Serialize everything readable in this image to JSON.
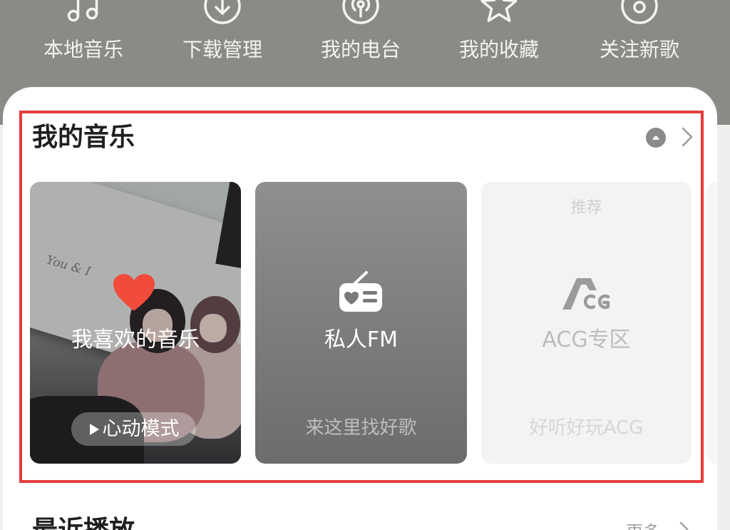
{
  "colors": {
    "header_bg": "#8b8a86",
    "highlight": "#e63c3c",
    "heart": "#f04b3b"
  },
  "top_nav": {
    "items": [
      {
        "label": "本地音乐",
        "icon": "music-note-icon"
      },
      {
        "label": "下载管理",
        "icon": "download-icon"
      },
      {
        "label": "我的电台",
        "icon": "podcast-icon"
      },
      {
        "label": "我的收藏",
        "icon": "star-icon"
      },
      {
        "label": "关注新歌",
        "icon": "disc-icon"
      }
    ]
  },
  "my_music": {
    "title": "我的音乐",
    "header_icons": [
      "circle-badge-icon",
      "chevron-right-icon"
    ],
    "cards": [
      {
        "title": "我喜欢的音乐",
        "button_label": "心动模式",
        "button_icon": "play-icon",
        "cover_text": "You & I",
        "icon": "heart-icon"
      },
      {
        "title": "私人FM",
        "subtitle": "来这里找好歌",
        "icon": "radio-icon"
      },
      {
        "tag": "推荐",
        "title": "ACG专区",
        "subtitle": "好听好玩ACG",
        "logo_text": "ACG",
        "icon": "acg-logo-icon"
      }
    ]
  },
  "recent": {
    "title": "最近播放",
    "more_label": "更多"
  }
}
